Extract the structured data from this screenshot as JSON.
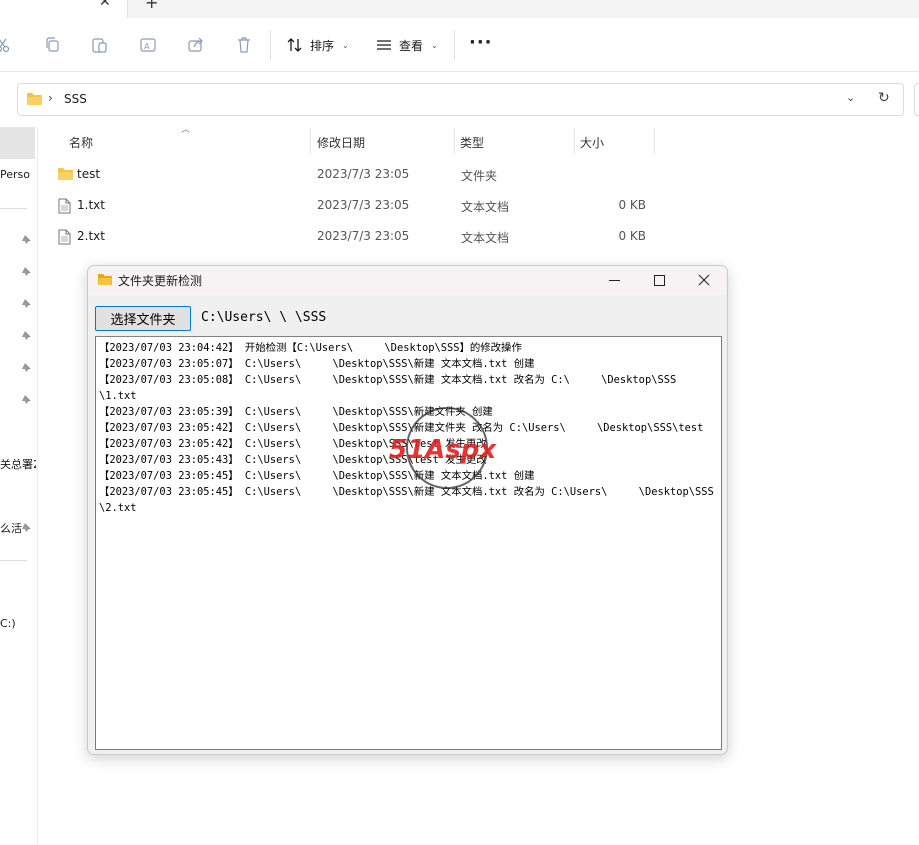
{
  "tabs": {
    "close_glyph": "✕",
    "new_glyph": "+"
  },
  "commandbar": {
    "icons": [
      "cut-icon",
      "copy-icon",
      "paste-icon",
      "rename-icon",
      "share-icon",
      "delete-icon"
    ],
    "sort_label": "排序",
    "view_label": "查看",
    "more_label": "···"
  },
  "address": {
    "path": "SSS",
    "chevron": "›"
  },
  "nav": {
    "items": [
      "Perso",
      "关总署2",
      "么活",
      "C:)"
    ]
  },
  "filelist": {
    "columns": [
      "名称",
      "修改日期",
      "类型",
      "大小"
    ],
    "rows": [
      {
        "name": "test",
        "date": "2023/7/3 23:05",
        "type": "文件夹",
        "size": "",
        "icon": "folder-icon"
      },
      {
        "name": "1.txt",
        "date": "2023/7/3 23:05",
        "type": "文本文档",
        "size": "0 KB",
        "icon": "text-file-icon"
      },
      {
        "name": "2.txt",
        "date": "2023/7/3 23:05",
        "type": "文本文档",
        "size": "0 KB",
        "icon": "text-file-icon"
      }
    ]
  },
  "window": {
    "title": "文件夹更新检测",
    "select_button": "选择文件夹",
    "folder_path": "C:\\Users\\     \\     \\SSS",
    "log": [
      "【2023/07/03 23:04:42】 开始检测【C:\\Users\\     \\Desktop\\SSS】的修改操作",
      "【2023/07/03 23:05:07】 C:\\Users\\     \\Desktop\\SSS\\新建 文本文档.txt 创建",
      "【2023/07/03 23:05:08】 C:\\Users\\     \\Desktop\\SSS\\新建 文本文档.txt 改名为 C:\\     \\Desktop\\SSS",
      "\\1.txt",
      "【2023/07/03 23:05:39】 C:\\Users\\     \\Desktop\\SSS\\新建文件夹 创建",
      "【2023/07/03 23:05:42】 C:\\Users\\     \\Desktop\\SSS\\新建文件夹 改名为 C:\\Users\\     \\Desktop\\SSS\\test",
      "【2023/07/03 23:05:42】 C:\\Users\\     \\Desktop\\SSS\\test 发生更改",
      "【2023/07/03 23:05:43】 C:\\Users\\     \\Desktop\\SSS\\test 发生更改",
      "【2023/07/03 23:05:45】 C:\\Users\\     \\Desktop\\SSS\\新建 文本文档.txt 创建",
      "【2023/07/03 23:05:45】 C:\\Users\\     \\Desktop\\SSS\\新建 文本文档.txt 改名为 C:\\Users\\     \\Desktop\\SSS",
      "\\2.txt"
    ]
  },
  "watermark": {
    "text": "51Aspx"
  },
  "colors": {
    "folder": "#f6c445",
    "accent": "#0078d7",
    "watermark_red": "#e02020",
    "watermark_green": "#3aa335"
  }
}
